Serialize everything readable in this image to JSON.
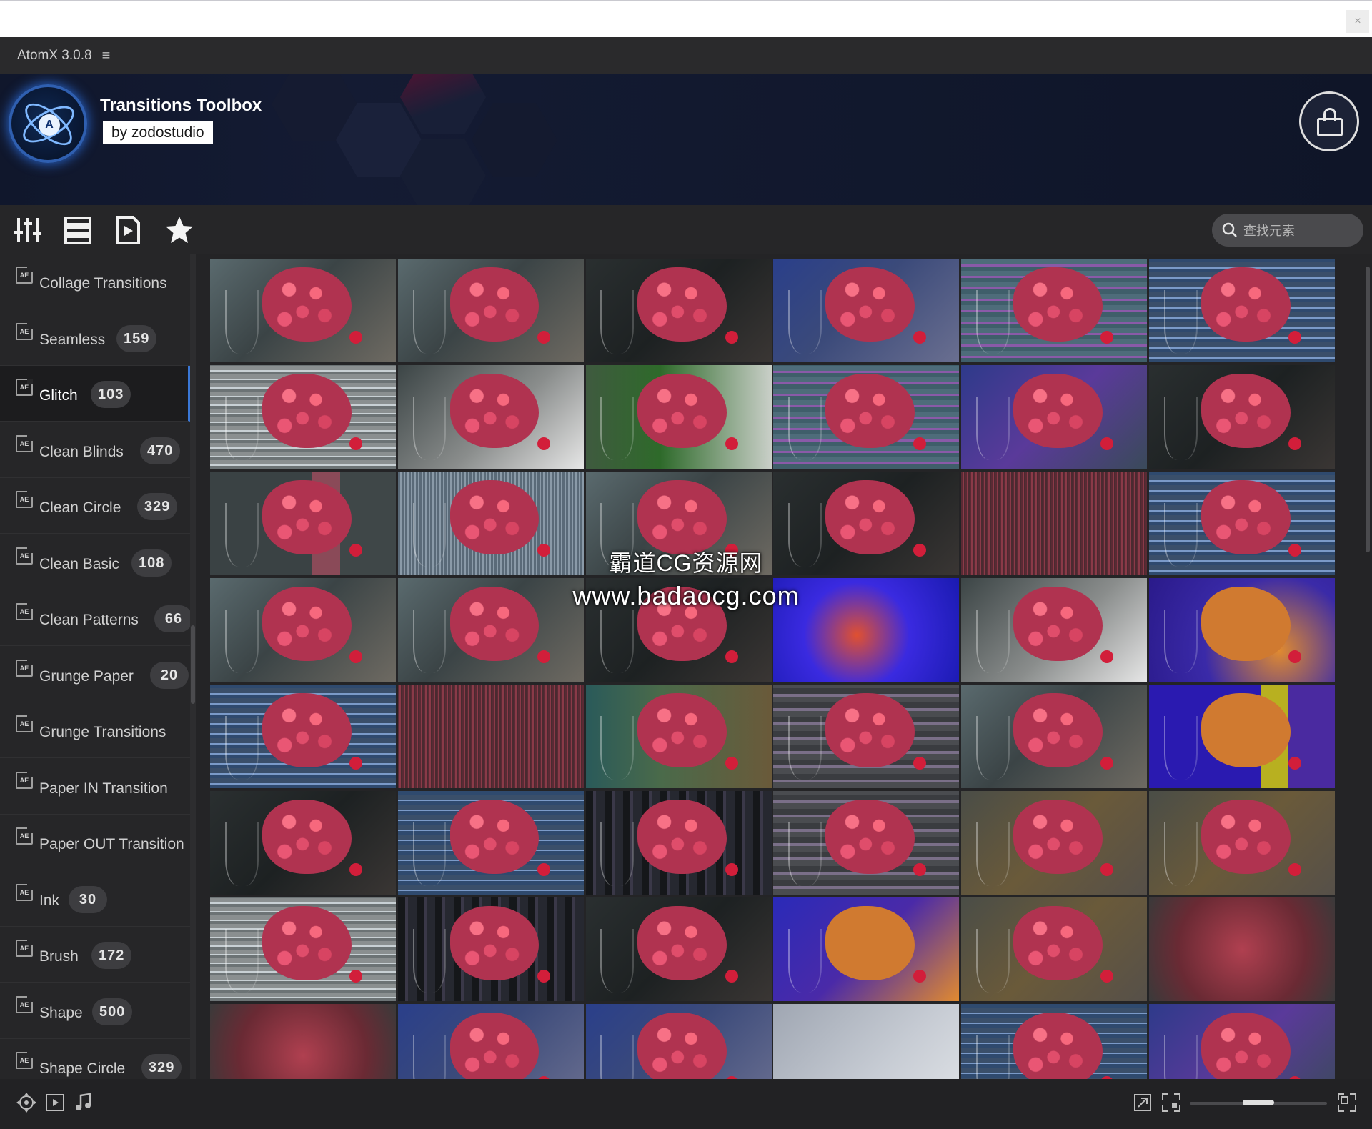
{
  "window": {
    "title": "AtomX 3.0.8",
    "menu_glyph": "≡",
    "close_glyph": "×"
  },
  "banner": {
    "title": "Transitions Toolbox",
    "byline": "by zodostudio",
    "logo_letter": "A"
  },
  "toolbar": {
    "search_placeholder": "查找元素"
  },
  "categories": [
    {
      "label": "Collage Transitions",
      "count": "",
      "active": false
    },
    {
      "label": "Seamless",
      "count": "159",
      "active": false
    },
    {
      "label": "Glitch",
      "count": "103",
      "active": true
    },
    {
      "label": "Clean Blinds",
      "count": "470",
      "active": false
    },
    {
      "label": "Clean Circle",
      "count": "329",
      "active": false
    },
    {
      "label": "Clean Basic",
      "count": "108",
      "active": false
    },
    {
      "label": "Clean Patterns",
      "count": "66",
      "active": false
    },
    {
      "label": "Grunge Paper",
      "count": "20",
      "active": false
    },
    {
      "label": "Grunge Transitions",
      "count": "",
      "active": false
    },
    {
      "label": "Paper IN Transition",
      "count": "",
      "active": false
    },
    {
      "label": "Paper OUT Transition",
      "count": "",
      "active": false
    },
    {
      "label": "Ink",
      "count": "30",
      "active": false
    },
    {
      "label": "Brush",
      "count": "172",
      "active": false
    },
    {
      "label": "Shape",
      "count": "500",
      "active": false
    },
    {
      "label": "Shape Circle",
      "count": "329",
      "active": false
    }
  ],
  "ae_badge": "AE",
  "thumbnails": [
    "natural",
    "natural",
    "dark",
    "blue",
    "glitch-pink",
    "glitch-blue",
    "glitch-white",
    "light",
    "green",
    "glitch-pink",
    "purple",
    "dark",
    "glitch-split",
    "glitch-grid",
    "natural",
    "dark",
    "streak",
    "glitch-blue",
    "natural",
    "natural",
    "dark",
    "burst-blue",
    "light",
    "indigo",
    "glitch-blue",
    "streak",
    "teal",
    "glitch-gray",
    "natural",
    "indigo-yellow",
    "dark",
    "glitch-blue",
    "glitch-dark",
    "glitch-gray",
    "warm",
    "warm",
    "glitch-white",
    "glitch-dark",
    "dark",
    "indigo-orange",
    "warm",
    "red-blur",
    "red-blur",
    "blue",
    "blue",
    "fade",
    "glitch-blue",
    "purple"
  ],
  "watermark": {
    "line1": "霸道CG资源网",
    "line2": "www.badaocg.com"
  },
  "zoom_level": 0.5
}
